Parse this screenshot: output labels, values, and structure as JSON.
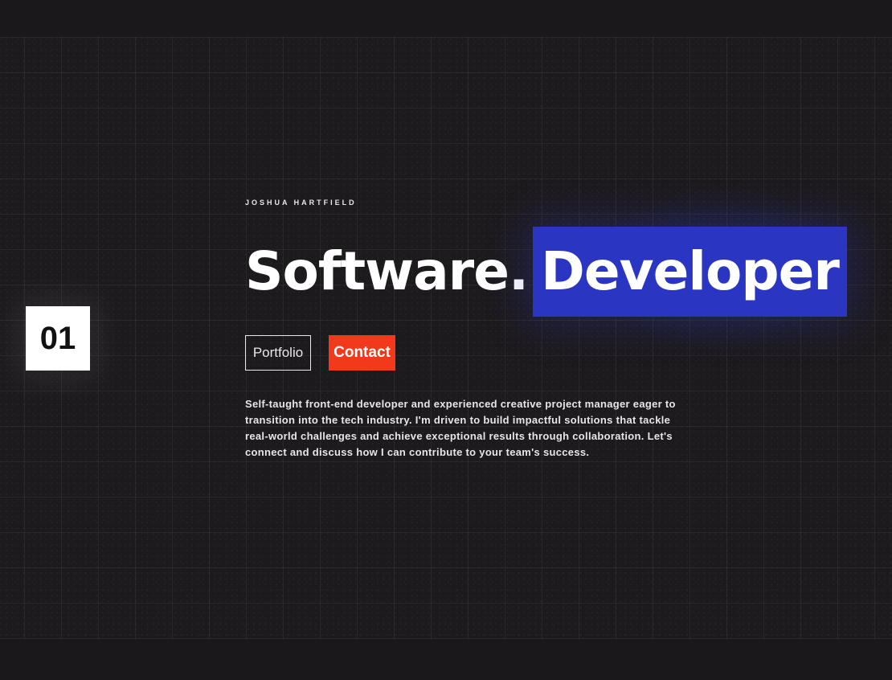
{
  "hero": {
    "section_number": "01",
    "author_name": "JOSHUA HARTFIELD",
    "headline_word": "Software.",
    "headline_highlight": "Developer",
    "buttons": {
      "portfolio_label": "Portfolio",
      "contact_label": "Contact"
    },
    "bio": "Self-taught front-end developer and experienced creative project manager eager to transition into the tech industry. I'm driven to build impactful solutions that tackle real-world challenges and achieve exceptional results through collaboration. Let's connect and discuss how I can contribute to your team's success."
  },
  "colors": {
    "background": "#1d1a1d",
    "highlight": "#2a36c2",
    "contact_button": "#f2391b",
    "text": "#ffffff"
  }
}
